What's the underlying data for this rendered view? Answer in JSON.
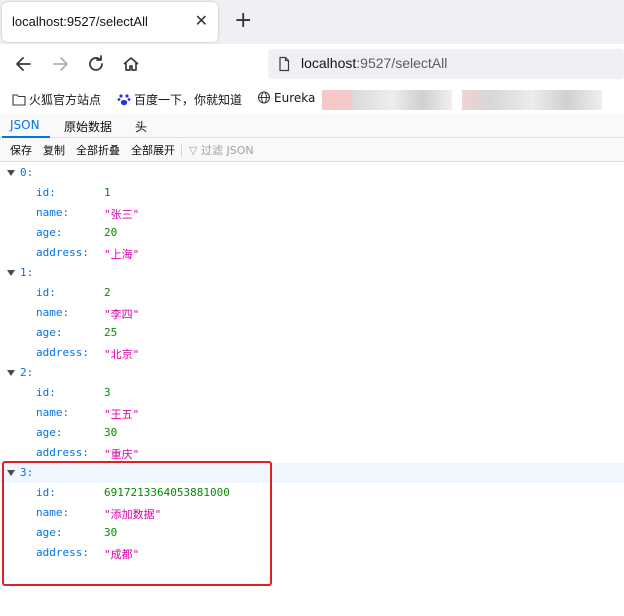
{
  "browser": {
    "tab_title": "localhost:9527/selectAll",
    "url_host": "localhost",
    "url_rest": ":9527/selectAll",
    "bookmarks": [
      "火狐官方站点",
      "百度一下，你就知道",
      "Eureka"
    ]
  },
  "json_viewer": {
    "tabs": [
      "JSON",
      "原始数据",
      "头"
    ],
    "toolbar": {
      "save": "保存",
      "copy": "复制",
      "collapse_all": "全部折叠",
      "expand_all": "全部展开",
      "filter_placeholder": "过滤 JSON"
    },
    "records": [
      {
        "index": "0:",
        "id": "1",
        "name": "\"张三\"",
        "age": "20",
        "address": "\"上海\""
      },
      {
        "index": "1:",
        "id": "2",
        "name": "\"李四\"",
        "age": "25",
        "address": "\"北京\""
      },
      {
        "index": "2:",
        "id": "3",
        "name": "\"王五\"",
        "age": "30",
        "address": "\"重庆\""
      },
      {
        "index": "3:",
        "id": "691721336405388​1000",
        "name": "\"添加数据\"",
        "age": "30",
        "address": "\"成都\""
      }
    ],
    "keys": {
      "id": "id:",
      "name": "name:",
      "age": "age:",
      "address": "address:"
    }
  },
  "colors": {
    "accent": "#0074e8",
    "number": "#058b00",
    "string": "#dd00a9",
    "highlight": "#e02020"
  }
}
